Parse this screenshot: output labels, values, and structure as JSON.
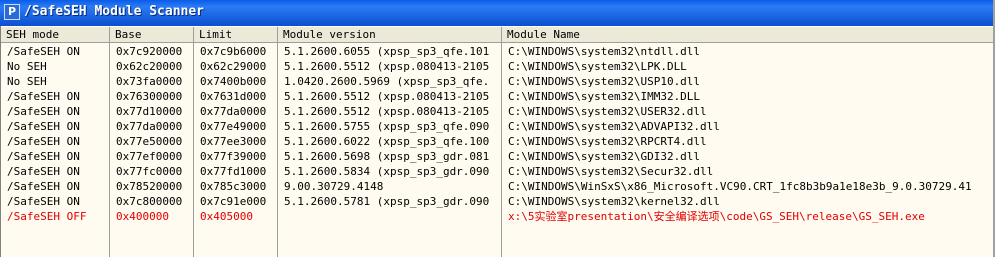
{
  "window": {
    "title": "/SafeSEH Module Scanner",
    "icon_letter": "P"
  },
  "columns": [
    "SEH mode",
    "Base",
    "Limit",
    "Module version",
    "Module Name"
  ],
  "rows": [
    {
      "mode": "/SafeSEH ON",
      "base": "0x7c920000",
      "limit": "0x7c9b6000",
      "version": "5.1.2600.6055 (xpsp_sp3_qfe.101",
      "name": "C:\\WINDOWS\\system32\\ntdll.dll"
    },
    {
      "mode": "No SEH",
      "base": "0x62c20000",
      "limit": "0x62c29000",
      "version": "5.1.2600.5512 (xpsp.080413-2105",
      "name": "C:\\WINDOWS\\system32\\LPK.DLL"
    },
    {
      "mode": "No SEH",
      "base": "0x73fa0000",
      "limit": "0x7400b000",
      "version": "1.0420.2600.5969 (xpsp_sp3_qfe.",
      "name": "C:\\WINDOWS\\system32\\USP10.dll"
    },
    {
      "mode": "/SafeSEH ON",
      "base": "0x76300000",
      "limit": "0x7631d000",
      "version": "5.1.2600.5512 (xpsp.080413-2105",
      "name": "C:\\WINDOWS\\system32\\IMM32.DLL"
    },
    {
      "mode": "/SafeSEH ON",
      "base": "0x77d10000",
      "limit": "0x77da0000",
      "version": "5.1.2600.5512 (xpsp.080413-2105",
      "name": "C:\\WINDOWS\\system32\\USER32.dll"
    },
    {
      "mode": "/SafeSEH ON",
      "base": "0x77da0000",
      "limit": "0x77e49000",
      "version": "5.1.2600.5755 (xpsp_sp3_qfe.090",
      "name": "C:\\WINDOWS\\system32\\ADVAPI32.dll"
    },
    {
      "mode": "/SafeSEH ON",
      "base": "0x77e50000",
      "limit": "0x77ee3000",
      "version": "5.1.2600.6022 (xpsp_sp3_qfe.100",
      "name": "C:\\WINDOWS\\system32\\RPCRT4.dll"
    },
    {
      "mode": "/SafeSEH ON",
      "base": "0x77ef0000",
      "limit": "0x77f39000",
      "version": "5.1.2600.5698 (xpsp_sp3_gdr.081",
      "name": "C:\\WINDOWS\\system32\\GDI32.dll"
    },
    {
      "mode": "/SafeSEH ON",
      "base": "0x77fc0000",
      "limit": "0x77fd1000",
      "version": "5.1.2600.5834 (xpsp_sp3_gdr.090",
      "name": "C:\\WINDOWS\\system32\\Secur32.dll"
    },
    {
      "mode": "/SafeSEH ON",
      "base": "0x78520000",
      "limit": "0x785c3000",
      "version": "9.00.30729.4148",
      "name": "C:\\WINDOWS\\WinSxS\\x86_Microsoft.VC90.CRT_1fc8b3b9a1e18e3b_9.0.30729.41"
    },
    {
      "mode": "/SafeSEH ON",
      "base": "0x7c800000",
      "limit": "0x7c91e000",
      "version": "5.1.2600.5781 (xpsp_sp3_gdr.090",
      "name": "C:\\WINDOWS\\system32\\kernel32.dll"
    },
    {
      "mode": "/SafeSEH OFF",
      "base": "0x400000",
      "limit": "0x405000",
      "version": "",
      "name": "x:\\5实验室presentation\\安全编译选项\\code\\GS_SEH\\release\\GS_SEH.exe",
      "highlight": true
    }
  ],
  "colors": {
    "title_bar": "#0a5ce8",
    "grid_background": "#fffbf0",
    "highlight_text": "#e00000"
  }
}
